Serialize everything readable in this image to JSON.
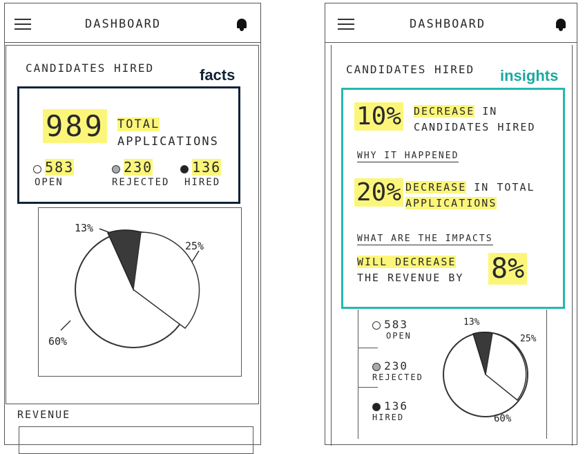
{
  "left": {
    "header": {
      "title": "DASHBOARD"
    },
    "section_title": "CANDIDATES HIRED",
    "facts_label": "facts",
    "total": {
      "value": "989",
      "label_line1": "TOTAL",
      "label_line2": "APPLICATIONS"
    },
    "stats": [
      {
        "value": "583",
        "label": "OPEN"
      },
      {
        "value": "230",
        "label": "REJECTED"
      },
      {
        "value": "136",
        "label": "HIRED"
      }
    ],
    "pie_labels": {
      "p13": "13%",
      "p25": "25%",
      "p60": "60%"
    },
    "revenue_title": "REVENUE"
  },
  "right": {
    "header": {
      "title": "DASHBOARD"
    },
    "section_title": "CANDIDATES HIRED",
    "insights_label": "insights",
    "insight1": {
      "value": "10%",
      "line1_hl": "DECREASE",
      "line1_rest": "IN",
      "line2": "CANDIDATES HIRED"
    },
    "why_title": "WHY IT HAPPENED",
    "insight2": {
      "value": "20%",
      "line1_hl": "DECREASE",
      "line1_rest": "IN TOTAL",
      "line2": "APPLICATIONS"
    },
    "impacts_title": "WHAT ARE THE IMPACTS",
    "insight3": {
      "line1": "WILL DECREASE",
      "line2": "THE REVENUE BY",
      "value": "8%"
    },
    "stats": [
      {
        "value": "583",
        "label": "OPEN"
      },
      {
        "value": "230",
        "label": "REJECTED"
      },
      {
        "value": "136",
        "label": "HIRED"
      }
    ],
    "pie_labels": {
      "p13": "13%",
      "p25": "25%",
      "p60": "60%"
    }
  },
  "colors": {
    "highlight": "#fbf67a",
    "facts_border": "#0f2236",
    "insights_border": "#22b8b0",
    "facts_text": "#0f2236",
    "insights_text": "#1aa8a0"
  }
}
